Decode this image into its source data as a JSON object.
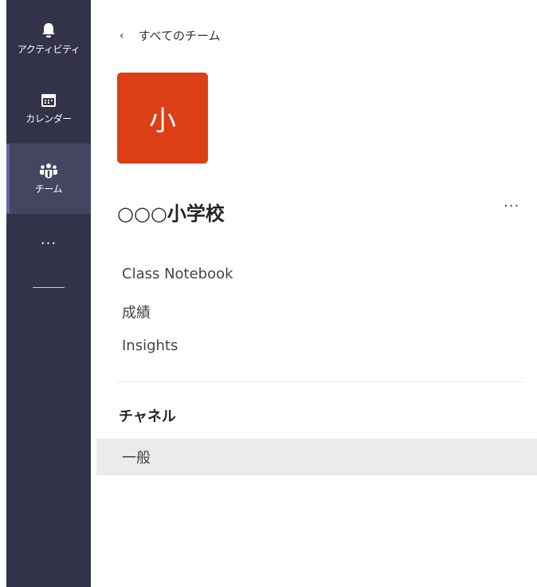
{
  "rail": {
    "items": [
      {
        "label": "アクティビティ",
        "icon": "bell-icon"
      },
      {
        "label": "カレンダー",
        "icon": "calendar-icon"
      },
      {
        "label": "チーム",
        "icon": "teams-icon"
      }
    ],
    "more": "···"
  },
  "header": {
    "back_label": "すべてのチーム",
    "back_icon": "‹"
  },
  "team": {
    "avatar_text": "小",
    "avatar_color": "#dc3e15",
    "name": "○○○小学校",
    "more": "···"
  },
  "apps": [
    {
      "label": "Class Notebook"
    },
    {
      "label": "成績"
    },
    {
      "label": "Insights"
    }
  ],
  "channels": {
    "title": "チャネル",
    "items": [
      {
        "label": "一般"
      }
    ]
  },
  "colors": {
    "rail_bg": "#33344a",
    "accent": "#6264a7"
  }
}
